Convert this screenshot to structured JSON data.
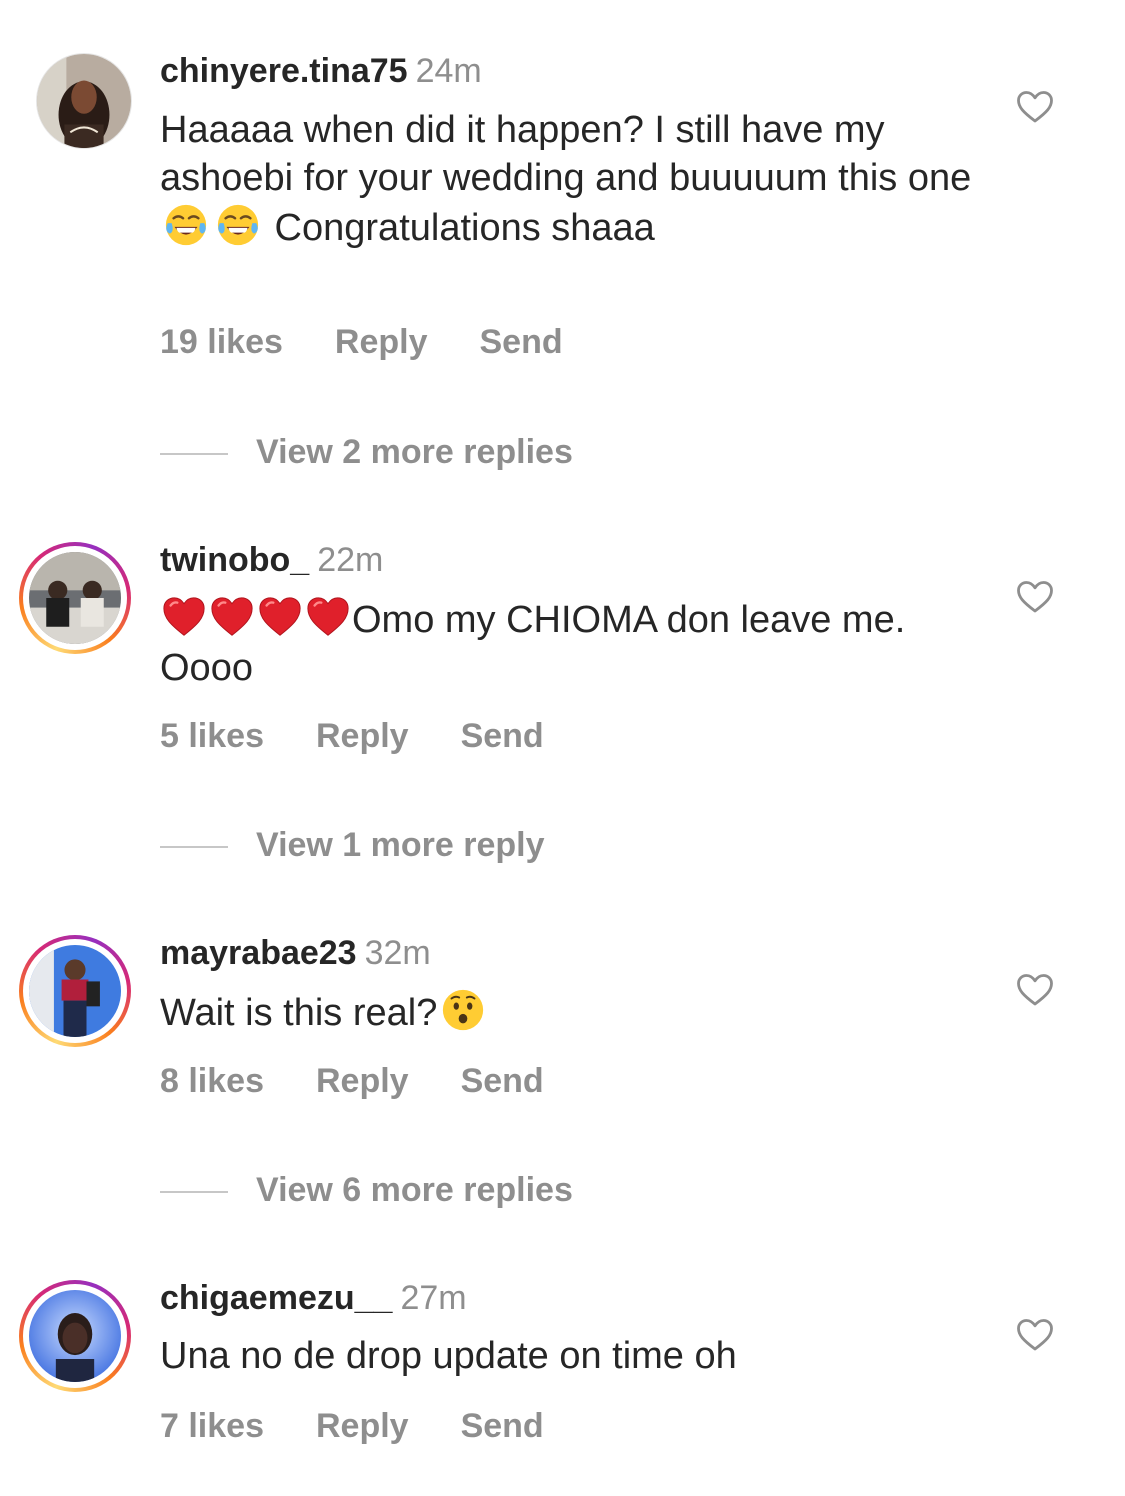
{
  "comments": [
    {
      "username": "chinyere.tina75",
      "time": "24m",
      "text_1": "Haaaaa when did it happen? I still have my ashoebi for your wedding and buuuuum this one",
      "emoji_1": "tears-of-joy-emoji",
      "emoji_2": "tears-of-joy-emoji",
      "text_2": " Congratulations shaaa",
      "likes": "19 likes",
      "reply": "Reply",
      "send": "Send",
      "view_replies": "View 2 more replies",
      "avatar_style": "plain"
    },
    {
      "username": "twinobo_",
      "time": "22m",
      "emojis": [
        "red-heart-emoji",
        "red-heart-emoji",
        "red-heart-emoji",
        "red-heart-emoji"
      ],
      "text_1": "Omo my CHIOMA don leave me. Oooo",
      "likes": "5 likes",
      "reply": "Reply",
      "send": "Send",
      "view_replies": "View 1 more reply",
      "avatar_style": "story-ring"
    },
    {
      "username": "mayrabae23",
      "time": "32m",
      "text_1": "Wait is this real?",
      "emoji_1": "astonished-face-emoji",
      "likes": "8 likes",
      "reply": "Reply",
      "send": "Send",
      "view_replies": "View 6 more replies",
      "avatar_style": "story-ring"
    },
    {
      "username": "chigaemezu__",
      "time": "27m",
      "text_1": "Una no de drop update on time oh",
      "likes": "7 likes",
      "reply": "Reply",
      "send": "Send",
      "avatar_style": "story-ring"
    }
  ],
  "colors": {
    "text": "#262626",
    "muted": "#8e8e8e",
    "divider": "#c7c7c7",
    "heart_outline": "#8e8e8e",
    "story_ring_start": "#feda75",
    "story_ring_mid": "#d62976",
    "story_ring_end": "#962fbf"
  },
  "icons": {
    "like": "heart-outline-icon"
  }
}
